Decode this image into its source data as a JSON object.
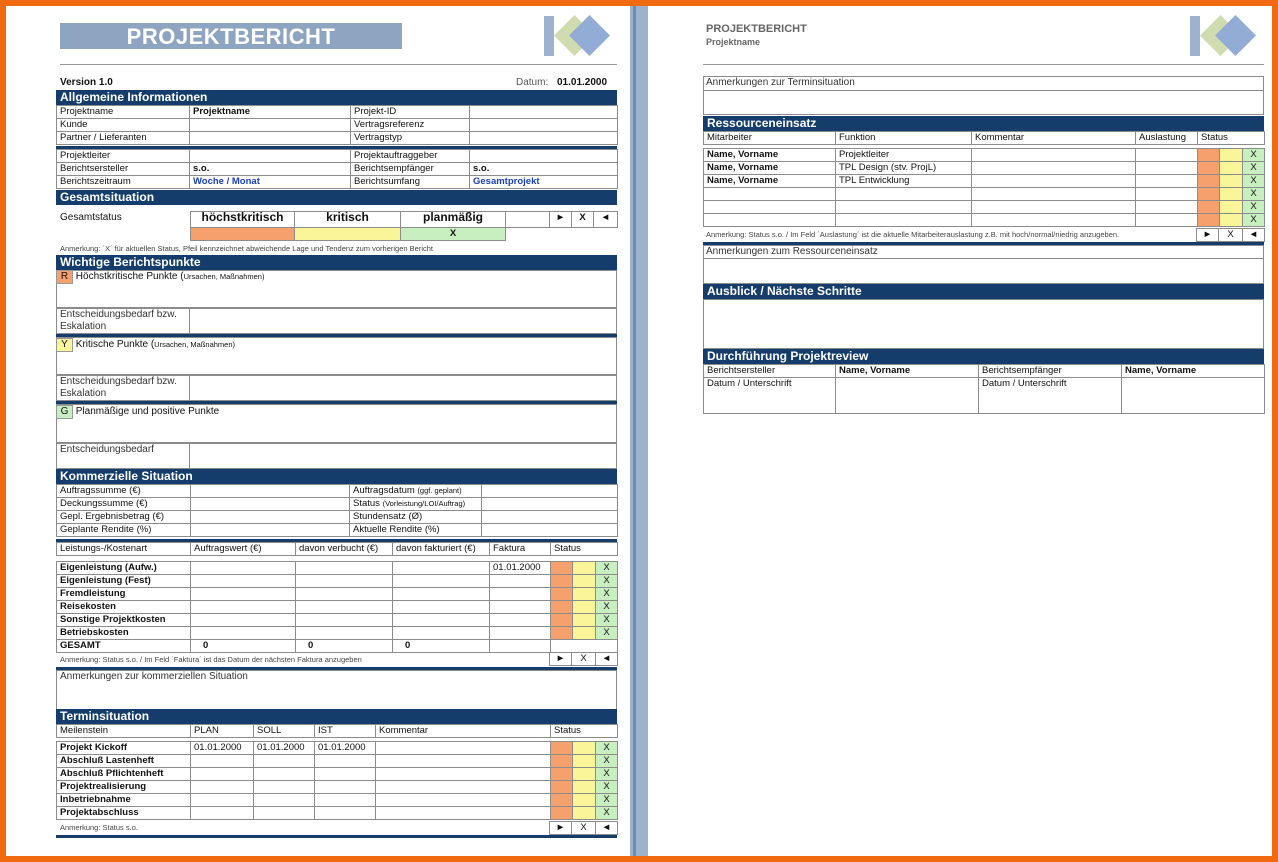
{
  "page1": {
    "title": "PROJEKTBERICHT",
    "version": "Version 1.0",
    "date_label": "Datum:",
    "date_value": "01.01.2000",
    "sections": {
      "general": "Allgemeine Informationen",
      "overall": "Gesamtsituation",
      "points": "Wichtige Berichtspunkte",
      "commercial": "Kommerzielle Situation",
      "schedule": "Terminsituation"
    },
    "general": {
      "projektname_label": "Projektname",
      "projektname_value": "Projektname",
      "projekt_id_label": "Projekt-ID",
      "kunde_label": "Kunde",
      "vertragsreferenz_label": "Vertragsreferenz",
      "partner_label": "Partner / Lieferanten",
      "vertragstyp_label": "Vertragstyp",
      "projektleiter_label": "Projektleiter",
      "auftraggeber_label": "Projektauftraggeber",
      "ersteller_label": "Berichtsersteller",
      "ersteller_value": "s.o.",
      "empfaenger_label": "Berichtsempfänger",
      "empfaenger_value": "s.o.",
      "zeitraum_label": "Berichtszeitraum",
      "zeitraum_value": "Woche / Monat",
      "umfang_label": "Berichtsumfang",
      "umfang_value": "Gesamtprojekt"
    },
    "overall": {
      "status_label": "Gesamtstatus",
      "hk": "höchstkritisch",
      "k": "kritisch",
      "p": "planmäßig",
      "arrow_right": "►",
      "x": "X",
      "arrow_left": "◄",
      "mark": "X",
      "note": "Anmerkung: ´X´ für aktuellen Status, Pfeil kennzeichnet abweichende Lage und Tendenz zum vorherigen Bericht"
    },
    "points": {
      "r_tag": "R",
      "r_label": "Höchstkritische Punkte (",
      "r_sub": "Ursachen, Maßnahmen)",
      "esc1": "Entscheidungsbedarf bzw.",
      "esc2": "Eskalation",
      "y_tag": "Y",
      "y_label": "Kritische Punkte (",
      "y_sub": "Ursachen, Maßnahmen)",
      "g_tag": "G",
      "g_label": "Planmäßige und positive Punkte",
      "eb": "Entscheidungsbedarf"
    },
    "commercial": {
      "auftragssumme": "Auftragssumme (€)",
      "auftragsdatum": "Auftragsdatum",
      "auftragsdatum_sub": "(ggf. geplant)",
      "deckungssumme": "Deckungssumme (€)",
      "status": "Status",
      "status_sub": "(Vorleistung/LOI/Auftrag)",
      "ergebnis": "Gepl. Ergebnisbetrag (€)",
      "stundensatz": "Stundensatz (Ø)",
      "rendite": "Geplante Rendite (%)",
      "akt_rendite": "Aktuelle Rendite (%)",
      "headers": [
        "Leistungs-/Kostenart",
        "Auftragswert (€)",
        "davon verbucht (€)",
        "davon fakturiert (€)",
        "Faktura",
        "Status"
      ],
      "rows": [
        {
          "name": "Eigenleistung (Aufw.)",
          "faktura": "01.01.2000",
          "x": "X"
        },
        {
          "name": "Eigenleistung (Fest)",
          "faktura": "",
          "x": "X"
        },
        {
          "name": "Fremdleistung",
          "faktura": "",
          "x": "X"
        },
        {
          "name": "Reisekosten",
          "faktura": "",
          "x": "X"
        },
        {
          "name": "Sonstige Projektkosten",
          "faktura": "",
          "x": "X"
        },
        {
          "name": "Betriebskosten",
          "faktura": "",
          "x": "X"
        }
      ],
      "total_label": "GESAMT",
      "total_a": "0",
      "total_b": "0",
      "total_c": "0",
      "note": "Anmerkung: Status s.o. / Im Feld ´Faktura´ ist das Datum der nächsten Faktura anzugeben",
      "remarks": "Anmerkungen zur kommerziellen Situation"
    },
    "schedule": {
      "headers": [
        "Meilenstein",
        "PLAN",
        "SOLL",
        "IST",
        "Kommentar",
        "Status"
      ],
      "rows": [
        {
          "name": "Projekt Kickoff",
          "plan": "01.01.2000",
          "soll": "01.01.2000",
          "ist": "01.01.2000",
          "x": "X"
        },
        {
          "name": "Abschluß Lastenheft",
          "plan": "",
          "soll": "",
          "ist": "",
          "x": "X"
        },
        {
          "name": "Abschluß Pflichtenheft",
          "plan": "",
          "soll": "",
          "ist": "",
          "x": "X"
        },
        {
          "name": "Projektrealisierung",
          "plan": "",
          "soll": "",
          "ist": "",
          "x": "X"
        },
        {
          "name": "Inbetriebnahme",
          "plan": "",
          "soll": "",
          "ist": "",
          "x": "X"
        },
        {
          "name": "Projektabschluss",
          "plan": "",
          "soll": "",
          "ist": "",
          "x": "X"
        }
      ],
      "note": "Anmerkung: Status s.o."
    }
  },
  "page2": {
    "title": "PROJEKTBERICHT",
    "subtitle": "Projektname",
    "schedule_remarks": "Anmerkungen zur Terminsituation",
    "resources_title": "Ressourceneinsatz",
    "resources_headers": [
      "Mitarbeiter",
      "Funktion",
      "Kommentar",
      "Auslastung",
      "Status"
    ],
    "resources_rows": [
      {
        "name": "Name, Vorname",
        "func": "Projektleiter",
        "x": "X"
      },
      {
        "name": "Name, Vorname",
        "func": "TPL Design (stv. ProjL)",
        "x": "X"
      },
      {
        "name": "Name, Vorname",
        "func": "TPL Entwicklung",
        "x": "X"
      },
      {
        "name": "",
        "func": "",
        "x": "X"
      },
      {
        "name": "",
        "func": "",
        "x": "X"
      },
      {
        "name": "",
        "func": "",
        "x": "X"
      }
    ],
    "resources_note": "Anmerkung: Status s.o. / Im Feld ´Auslastung´ ist die aktuelle Mitarbeiterauslastung z.B. mit hoch/normal/niedrig anzugeben.",
    "resources_remarks": "Anmerkungen zum Ressourceneinsatz",
    "outlook_title": "Ausblick / Nächste Schritte",
    "review_title": "Durchführung Projektreview",
    "review_ersteller": "Berichtsersteller",
    "review_name1": "Name, Vorname",
    "review_empfaenger": "Berichtsempfänger",
    "review_name2": "Name, Vorname",
    "sign1": "Datum / Unterschrift",
    "sign2": "Datum / Unterschrift",
    "arrow_right": "►",
    "x": "X",
    "arrow_left": "◄"
  },
  "colors": {
    "header": "#143d6b",
    "red": "#f6a06e",
    "yellow": "#fbf59a",
    "green": "#c8efc0",
    "frame": "#f26a10"
  }
}
